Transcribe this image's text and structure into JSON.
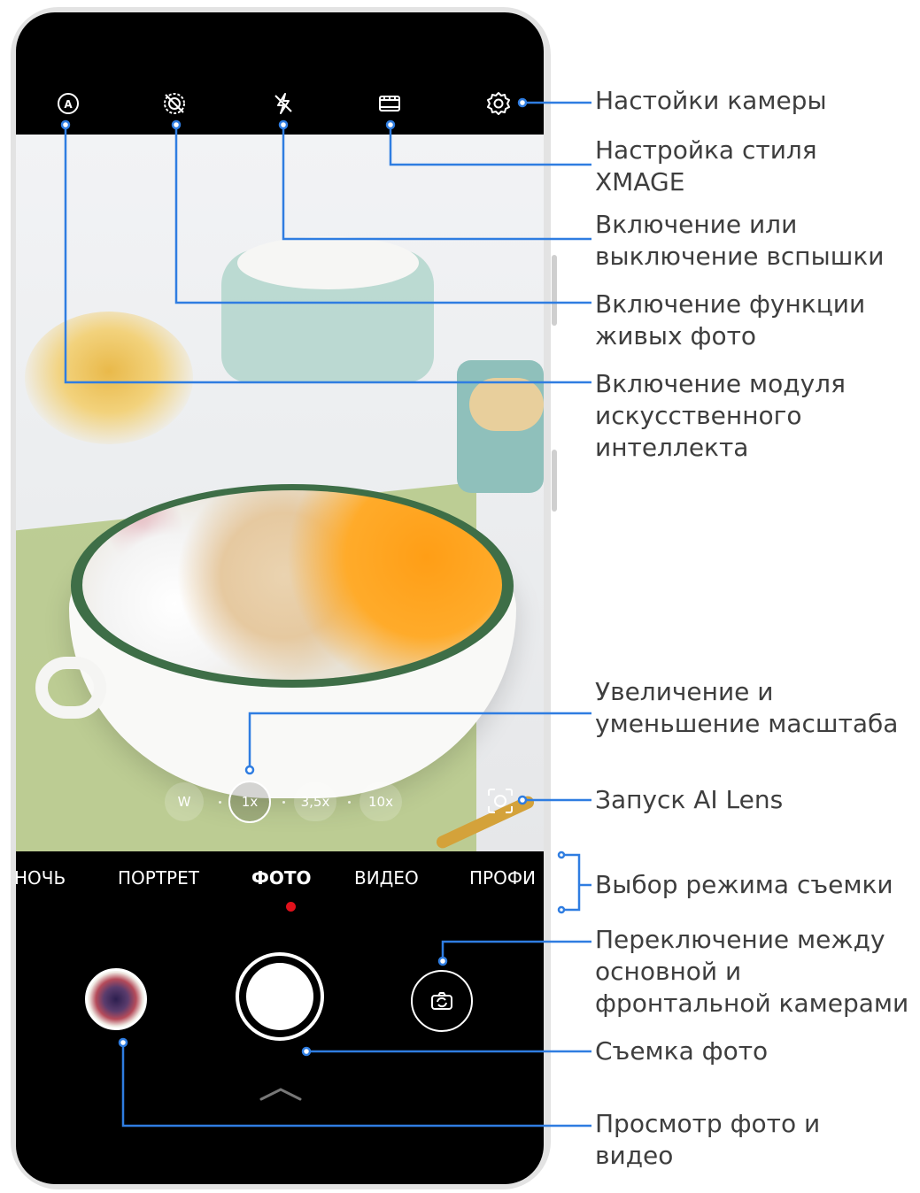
{
  "camera": {
    "top_icons": [
      "ai-icon",
      "live-photo-off-icon",
      "flash-off-icon",
      "xmage-style-icon",
      "settings-gear-icon"
    ],
    "zoom": {
      "levels": [
        "W",
        "1x",
        "3,5x",
        "10x"
      ],
      "active": "1x"
    },
    "modes": {
      "items": [
        "НОЧЬ",
        "ПОРТРЕТ",
        "ФОТО",
        "ВИДЕО",
        "ПРОФИ"
      ],
      "active": "ФОТО"
    },
    "accent_color": "#e0111b",
    "leader_color": "#2f7de1"
  },
  "callouts": [
    {
      "lines": [
        "Настойки камеры"
      ]
    },
    {
      "lines": [
        "Настройка стиля",
        "XMAGE"
      ]
    },
    {
      "lines": [
        "Включение или",
        "выключение вспышки"
      ]
    },
    {
      "lines": [
        "Включение функции",
        "живых фото"
      ]
    },
    {
      "lines": [
        "Включение модуля",
        "искусственного",
        "интеллекта"
      ]
    },
    {
      "lines": [
        "Увеличение и",
        "уменьшение масштаба"
      ]
    },
    {
      "lines": [
        "Запуск AI Lens"
      ]
    },
    {
      "lines": [
        "Выбор режима съемки"
      ]
    },
    {
      "lines": [
        "Переключение между",
        "основной и",
        "фронтальной камерами"
      ]
    },
    {
      "lines": [
        "Съемка фото"
      ]
    },
    {
      "lines": [
        "Просмотр фото и",
        "видео"
      ]
    }
  ]
}
